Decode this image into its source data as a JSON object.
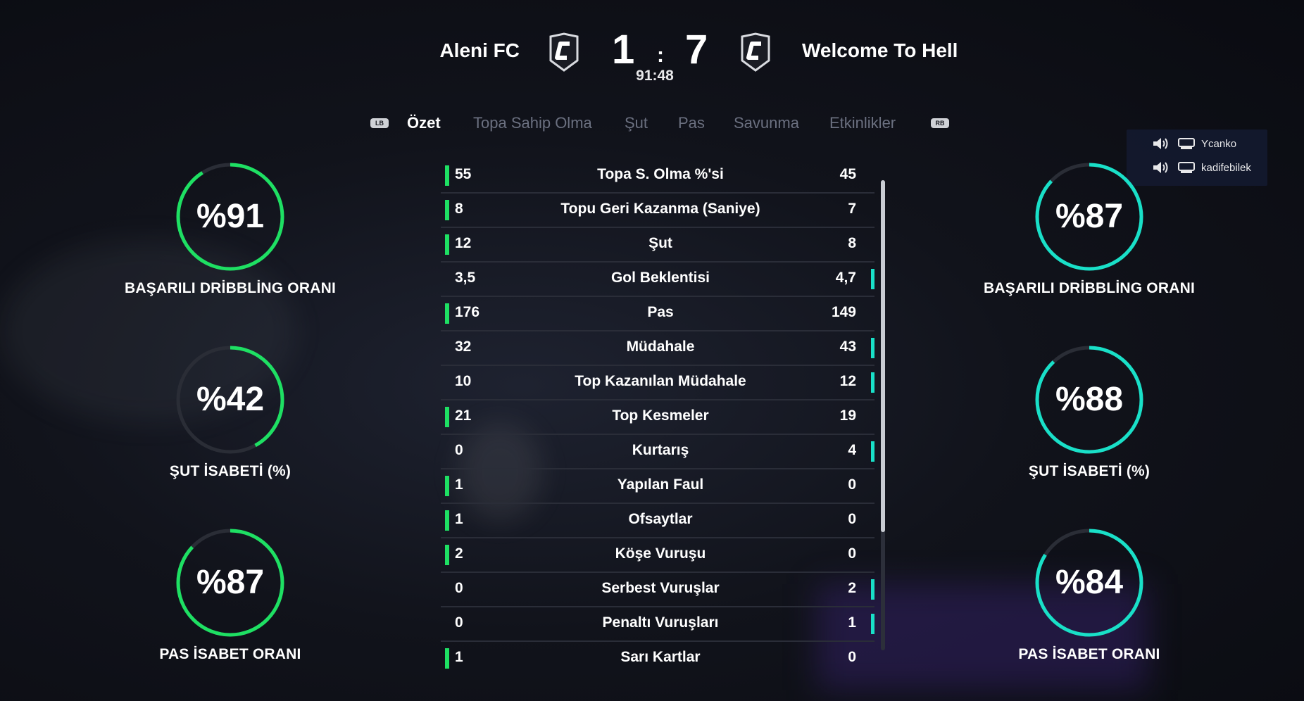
{
  "match": {
    "home_team": "Aleni FC",
    "away_team": "Welcome To Hell",
    "home_score": "1",
    "score_separator": ":",
    "away_score": "7",
    "clock": "91:48",
    "crest_icon": "club-crest-icon"
  },
  "tabs": {
    "lb": "LB",
    "rb": "RB",
    "items": [
      "Özet",
      "Topa Sahip Olma",
      "Şut",
      "Pas",
      "Savunma",
      "Etkinlikler"
    ],
    "active_index": 0
  },
  "voice_chat": {
    "users": [
      {
        "name": "Ycanko",
        "icon": "speaker-icon"
      },
      {
        "name": "kadifebilek",
        "icon": "speaker-icon"
      }
    ]
  },
  "gauges": {
    "home": [
      {
        "value": "%91",
        "label": "BAŞARILI DRİBBLİNG ORANI",
        "fraction": 0.91
      },
      {
        "value": "%42",
        "label": "ŞUT İSABETİ (%)",
        "fraction": 0.42
      },
      {
        "value": "%87",
        "label": "PAS İSABET ORANI",
        "fraction": 0.87
      }
    ],
    "away": [
      {
        "value": "%87",
        "label": "BAŞARILI DRİBBLİNG ORANI",
        "fraction": 0.87
      },
      {
        "value": "%88",
        "label": "ŞUT İSABETİ (%)",
        "fraction": 0.88
      },
      {
        "value": "%84",
        "label": "PAS İSABET ORANI",
        "fraction": 0.84
      }
    ],
    "home_color": "#1ee063",
    "away_color": "#19e0c8",
    "track_color": "#2a2d36"
  },
  "stats": [
    {
      "name": "Topa S. Olma %'si",
      "home": "55",
      "away": "45",
      "leader": "home"
    },
    {
      "name": "Topu Geri Kazanma (Saniye)",
      "home": "8",
      "away": "7",
      "leader": "home"
    },
    {
      "name": "Şut",
      "home": "12",
      "away": "8",
      "leader": "home"
    },
    {
      "name": "Gol Beklentisi",
      "home": "3,5",
      "away": "4,7",
      "leader": "away"
    },
    {
      "name": "Pas",
      "home": "176",
      "away": "149",
      "leader": "home"
    },
    {
      "name": "Müdahale",
      "home": "32",
      "away": "43",
      "leader": "away"
    },
    {
      "name": "Top Kazanılan Müdahale",
      "home": "10",
      "away": "12",
      "leader": "away"
    },
    {
      "name": "Top Kesmeler",
      "home": "21",
      "away": "19",
      "leader": "home"
    },
    {
      "name": "Kurtarış",
      "home": "0",
      "away": "4",
      "leader": "away"
    },
    {
      "name": "Yapılan Faul",
      "home": "1",
      "away": "0",
      "leader": "home"
    },
    {
      "name": "Ofsaytlar",
      "home": "1",
      "away": "0",
      "leader": "home"
    },
    {
      "name": "Köşe Vuruşu",
      "home": "2",
      "away": "0",
      "leader": "home"
    },
    {
      "name": "Serbest Vuruşlar",
      "home": "0",
      "away": "2",
      "leader": "away"
    },
    {
      "name": "Penaltı Vuruşları",
      "home": "0",
      "away": "1",
      "leader": "away"
    },
    {
      "name": "Sarı Kartlar",
      "home": "1",
      "away": "0",
      "leader": "home"
    }
  ]
}
